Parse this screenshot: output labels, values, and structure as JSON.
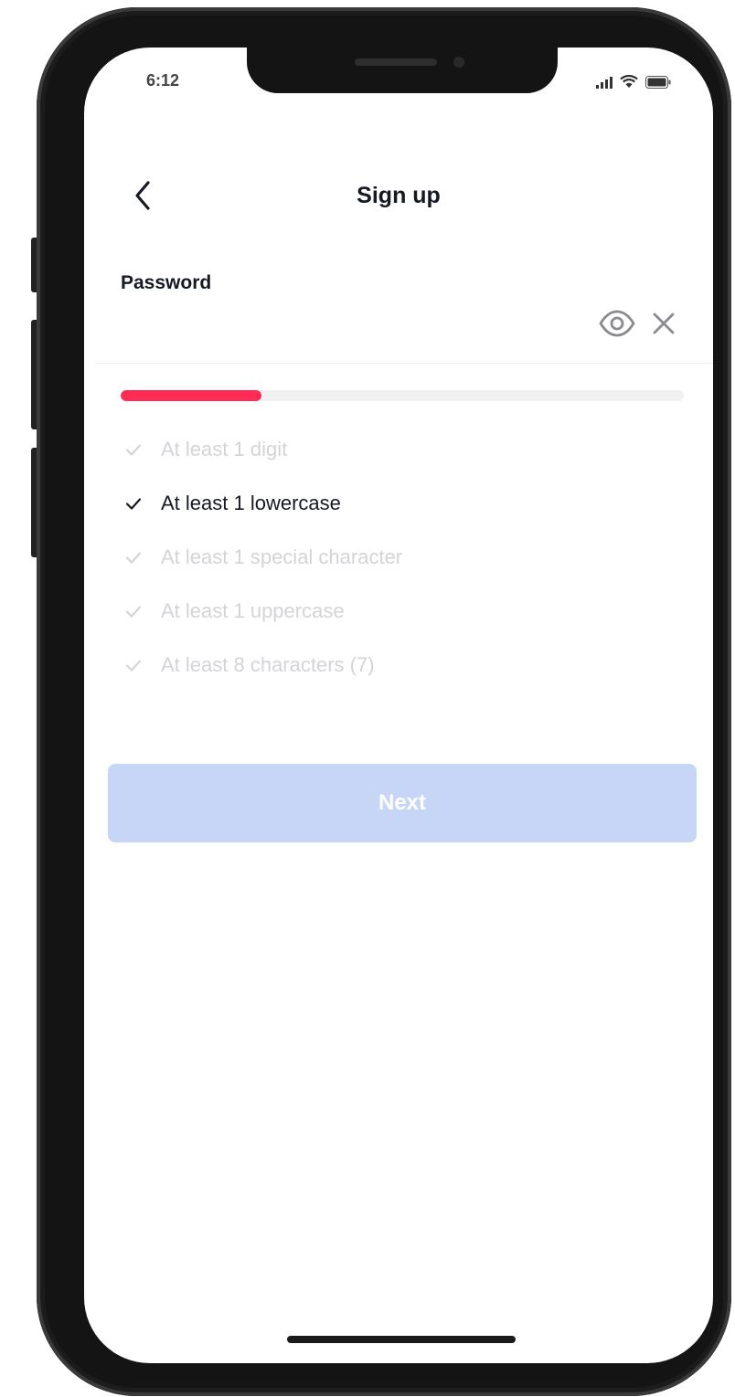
{
  "status_bar": {
    "time": "6:12"
  },
  "header": {
    "title": "Sign up",
    "back_icon": "chevron-left-icon"
  },
  "password_field": {
    "label": "Password",
    "value": "",
    "show_icon": "eye-icon",
    "clear_icon": "close-icon"
  },
  "strength": {
    "level": 0.25,
    "color": "#fe2c55"
  },
  "requirements": [
    {
      "text": "At least 1 digit",
      "met": false
    },
    {
      "text": "At least 1 lowercase",
      "met": true
    },
    {
      "text": "At least 1 special character",
      "met": false
    },
    {
      "text": "At least 1 uppercase",
      "met": false
    },
    {
      "text": "At least 8 characters (7)",
      "met": false
    }
  ],
  "next_button": {
    "label": "Next",
    "enabled": false,
    "background": "#c7d5f6"
  }
}
